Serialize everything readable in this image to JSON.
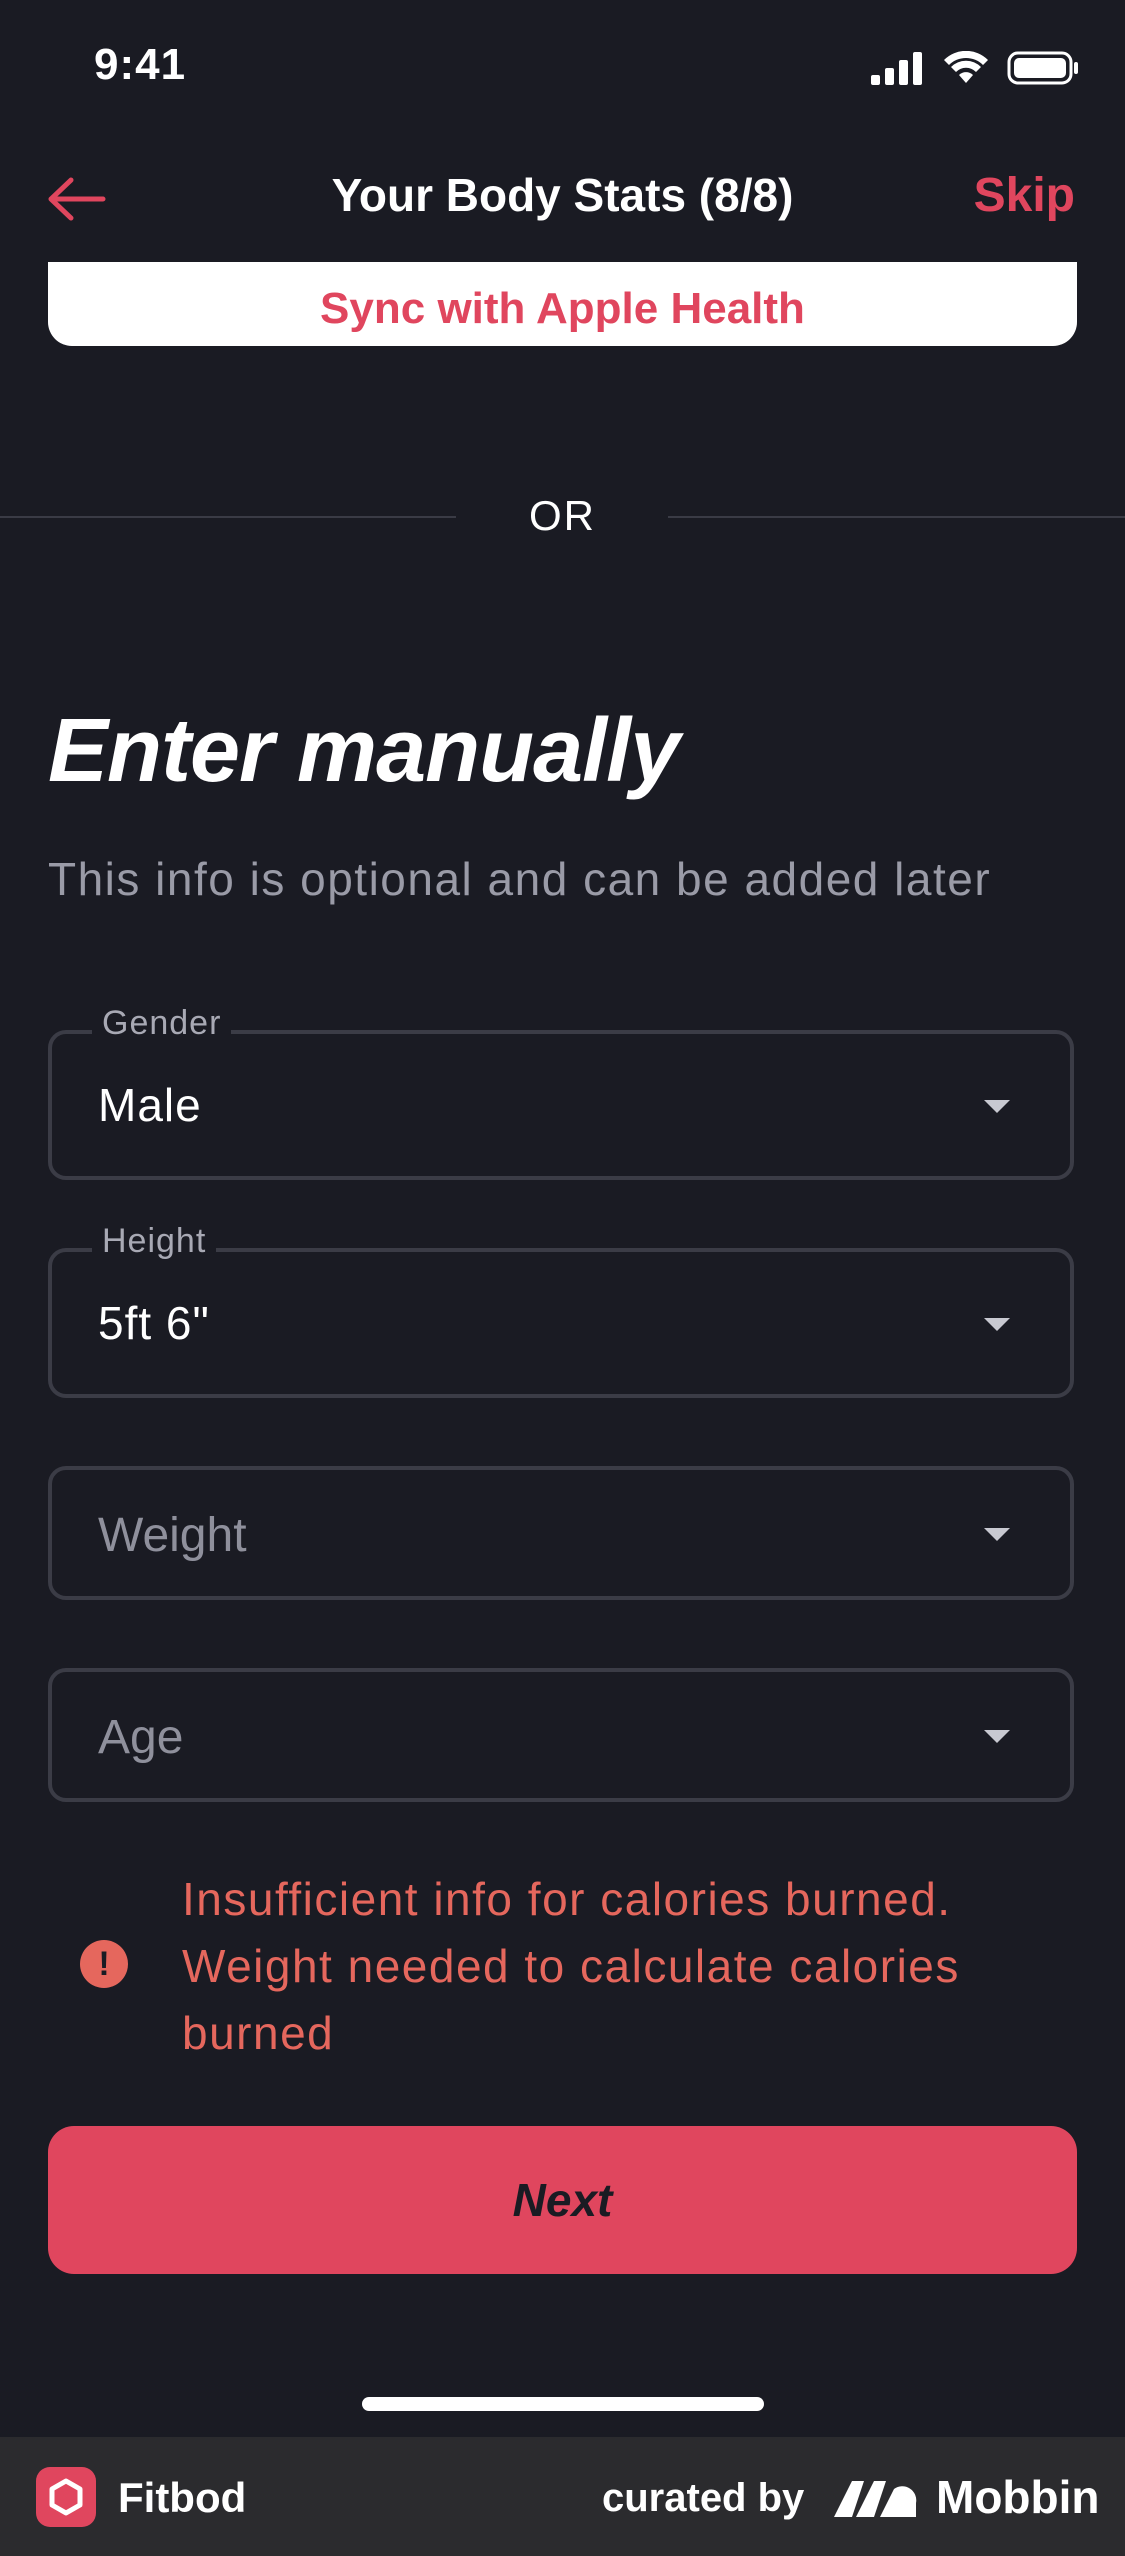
{
  "status_bar": {
    "time": "9:41"
  },
  "header": {
    "title": "Your Body Stats (8/8)",
    "skip_label": "Skip"
  },
  "sync": {
    "label": "Sync with Apple Health"
  },
  "divider": {
    "label": "OR"
  },
  "manual": {
    "title": "Enter manually",
    "subtitle": "This info is optional and can be added later"
  },
  "fields": {
    "gender": {
      "label": "Gender",
      "value": "Male"
    },
    "height": {
      "label": "Height",
      "value": "5ft 6\""
    },
    "weight": {
      "placeholder": "Weight"
    },
    "age": {
      "placeholder": "Age"
    }
  },
  "warning": {
    "text": "Insufficient info for calories burned. Weight needed to calculate calories burned",
    "icon": "exclamation-circle-icon"
  },
  "next_label": "Next",
  "footer": {
    "app_name": "Fitbod",
    "curated_by": "curated by",
    "brand": "Mobbin"
  },
  "colors": {
    "accent": "#e0465e",
    "background": "#1a1b23",
    "warning": "#e5675d"
  }
}
